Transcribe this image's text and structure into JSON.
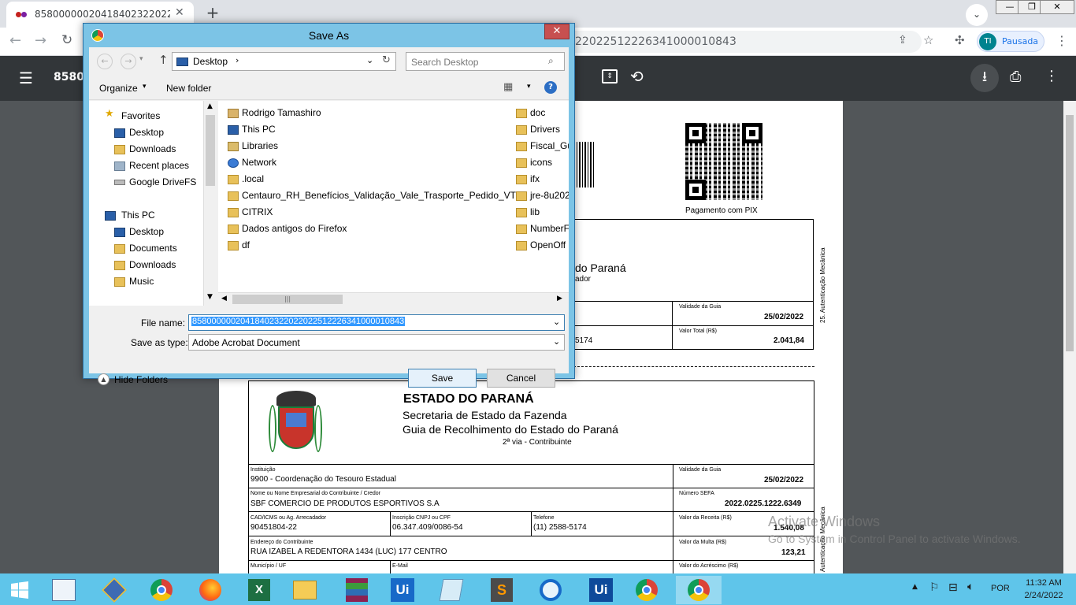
{
  "browser": {
    "tab_title": "8580000002041840232202202251",
    "url_visible": "2202251222634100001084 3",
    "url_tail": "22022512226341000010843",
    "profile_initials": "TI",
    "profile_status": "Pausada",
    "pdf_title_partial": "858000"
  },
  "pdf": {
    "qr_caption": "Pagamento com PIX",
    "side_label": "25. Autenticação Mecânica",
    "upper_title_partial": "do Paraná",
    "upper_sub_partial": "ador",
    "upper_validade_label": "Validade da Guia",
    "upper_validade_value": "25/02/2022",
    "upper_valor_label": "Valor Total (R$)",
    "upper_valor_value": "2.041,84",
    "upper_phone_partial": "5174",
    "state": "ESTADO DO PARANÁ",
    "secretaria": "Secretaria de Estado da Fazenda",
    "guia": "Guia de Recolhimento do Estado do Paraná",
    "via": "2ª via - Contribuinte",
    "instituicao_label": "Instituição",
    "instituicao_value": "9900 - Coordenação do Tesouro Estadual",
    "validade_label": "Validade da Guia",
    "validade_value": "25/02/2022",
    "nome_label": "Nome ou Nome Empresarial do Contribuinte / Credor",
    "nome_value": "SBF COMERCIO DE PRODUTOS ESPORTIVOS S.A",
    "sefa_label": "Número SEFA",
    "sefa_value": "2022.0225.1222.6349",
    "cad_label": "CAD/ICMS ou Ag. Arrecadador",
    "cad_value": "90451804-22",
    "cnpj_label": "Inscrição CNPJ ou CPF",
    "cnpj_value": "06.347.409/0086-54",
    "tel_label": "Telefone",
    "tel_value": "(11) 2588-5174",
    "receita_label": "Valor da Receita (R$)",
    "receita_value": "1.540,08",
    "end_label": "Endereço do Contribuinte",
    "end_value": "RUA IZABEL A REDENTORA 1434 (LUC) 177 CENTRO",
    "multa_label": "Valor da Multa (R$)",
    "multa_value": "123,21",
    "municipio_label": "Município / UF",
    "email_label": "E-Mail",
    "acrescimo_label": "Valor do Acréscimo (R$)",
    "side_label2": "Autenticação Mecânica"
  },
  "watermark": {
    "line1": "Activate Windows",
    "line2": "Go to System in Control Panel to activate Windows."
  },
  "dialog": {
    "title": "Save As",
    "location": "Desktop",
    "search_placeholder": "Search Desktop",
    "organize": "Organize",
    "new_folder": "New folder",
    "nav": {
      "favorites": "Favorites",
      "fav_items": [
        "Desktop",
        "Downloads",
        "Recent places",
        "Google DriveFS"
      ],
      "this_pc": "This PC",
      "pc_items": [
        "Desktop",
        "Documents",
        "Downloads",
        "Music"
      ]
    },
    "files_col1": [
      "Rodrigo Tamashiro",
      "This PC",
      "Libraries",
      "Network",
      ".local",
      "Centauro_RH_Benefícios_Validação_Vale_Trasporte_Pedido_VT",
      "CITRIX",
      "Dados antigos do Firefox",
      "df"
    ],
    "files_col2": [
      "doc",
      "Drivers",
      "Fiscal_Gu",
      "icons",
      "ifx",
      "jre-8u202",
      "lib",
      "NumberF",
      "OpenOff"
    ],
    "file_name_label": "File name:",
    "file_name_value": "85800000020418402322022022512226341000010843",
    "save_type_label": "Save as type:",
    "save_type_value": "Adobe Acrobat Document",
    "hide_folders": "Hide Folders",
    "save": "Save",
    "cancel": "Cancel"
  },
  "taskbar": {
    "lang": "POR",
    "time": "11:32 AM",
    "date": "2/24/2022",
    "apps": [
      "server-manager",
      "network-tool",
      "chrome",
      "firefox",
      "excel",
      "file-explorer",
      "winrar",
      "uipath-studio",
      "notepad",
      "sublime-text",
      "uipath-assistant",
      "uipath-robot",
      "chrome-profile",
      "chrome-active"
    ]
  }
}
